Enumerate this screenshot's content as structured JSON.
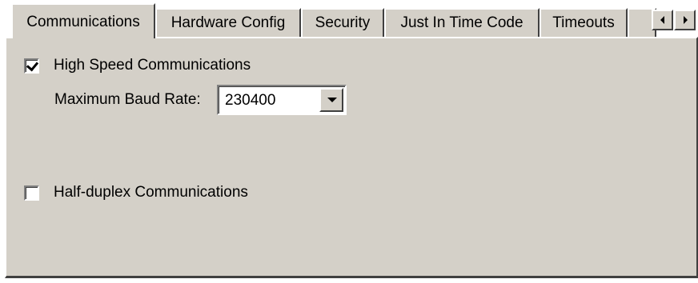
{
  "tabs": [
    {
      "label": "Communications",
      "active": true
    },
    {
      "label": "Hardware Config",
      "active": false
    },
    {
      "label": "Security",
      "active": false
    },
    {
      "label": "Just In Time Code",
      "active": false
    },
    {
      "label": "Timeouts",
      "active": false
    }
  ],
  "scroll_arrows": {
    "left_icon": "arrow-left-icon",
    "right_icon": "arrow-right-icon"
  },
  "communications": {
    "high_speed": {
      "label": "High Speed Communications",
      "checked": true
    },
    "baud_rate": {
      "label": "Maximum Baud Rate:",
      "value": "230400",
      "icon": "chevron-down-icon"
    },
    "half_duplex": {
      "label": "Half-duplex Communications",
      "checked": false
    }
  },
  "colors": {
    "face": "#d4d0c8",
    "highlight": "#ffffff",
    "shadow": "#808080",
    "dark_shadow": "#404040"
  }
}
